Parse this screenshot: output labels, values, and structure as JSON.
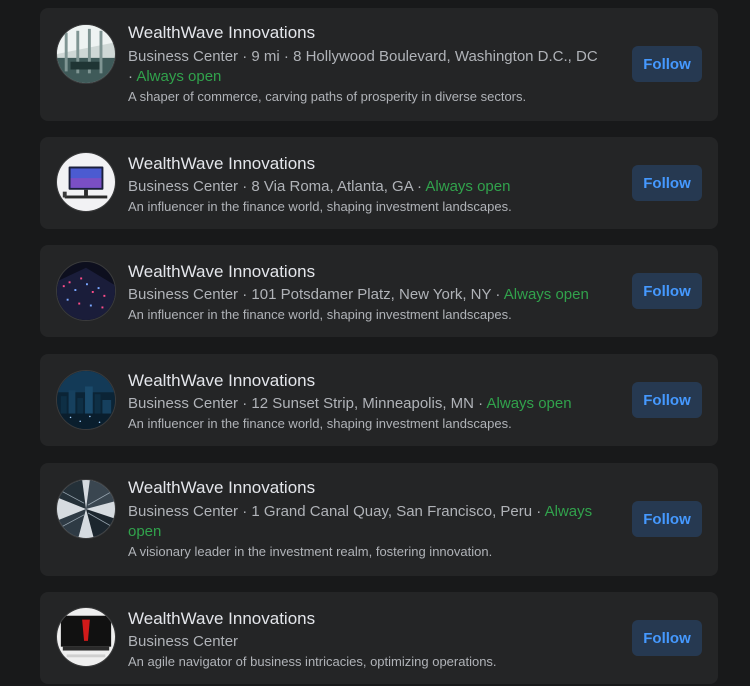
{
  "results": [
    {
      "name": "WealthWave Innovations",
      "category": "Business Center",
      "distance": "9 mi",
      "address": "8 Hollywood Boulevard, Washington D.C., DC",
      "hours": "Always open",
      "description": "A shaper of commerce, carving paths of prosperity in diverse sectors.",
      "follow_label": "Follow"
    },
    {
      "name": "WealthWave Innovations",
      "category": "Business Center",
      "address": "8 Via Roma, Atlanta, GA",
      "hours": "Always open",
      "description": "An influencer in the finance world, shaping investment landscapes.",
      "follow_label": "Follow"
    },
    {
      "name": "WealthWave Innovations",
      "category": "Business Center",
      "address": "101 Potsdamer Platz, New York, NY",
      "hours": "Always open",
      "description": "An influencer in the finance world, shaping investment landscapes.",
      "follow_label": "Follow"
    },
    {
      "name": "WealthWave Innovations",
      "category": "Business Center",
      "address": "12 Sunset Strip, Minneapolis, MN",
      "hours": "Always open",
      "description": "An influencer in the finance world, shaping investment landscapes.",
      "follow_label": "Follow"
    },
    {
      "name": "WealthWave Innovations",
      "category": "Business Center",
      "address": "1 Grand Canal Quay, San Francisco, Peru",
      "hours": "Always open",
      "description": "A visionary leader in the investment realm, fostering innovation.",
      "follow_label": "Follow"
    },
    {
      "name": "WealthWave Innovations",
      "category": "Business Center",
      "description": "An agile navigator of business intricacies, optimizing operations.",
      "follow_label": "Follow"
    }
  ],
  "separator": " · ",
  "colors": {
    "background": "#18191a",
    "card": "#242526",
    "open_green": "#31a24c",
    "follow_bg": "#263951",
    "follow_text": "#4599ff"
  }
}
